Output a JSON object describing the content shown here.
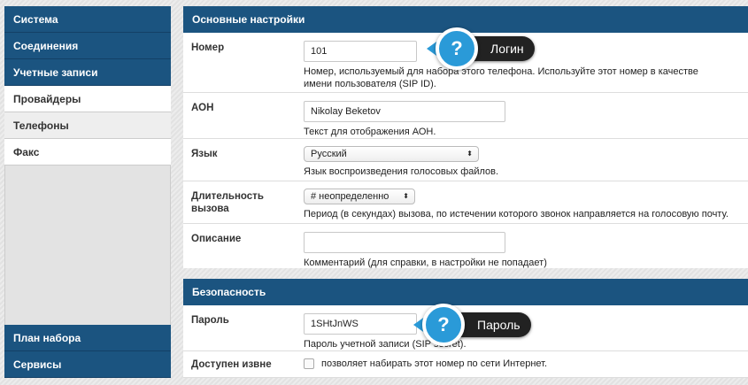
{
  "sidebar": {
    "top": [
      "Система",
      "Соединения",
      "Учетные записи"
    ],
    "sub": [
      "Провайдеры",
      "Телефоны",
      "Факс"
    ],
    "bottom": [
      "План набора",
      "Сервисы"
    ]
  },
  "basic": {
    "title": "Основные настройки",
    "number": {
      "label": "Номер",
      "value": "101",
      "desc": "Номер, используемый для набора этого телефона. Используйте этот номер в качестве имени пользователя (SIP ID)."
    },
    "aon": {
      "label": "АОН",
      "value": "Nikolay Beketov",
      "desc": "Текст для отображения АОН."
    },
    "lang": {
      "label": "Язык",
      "value": "Русский",
      "desc": "Язык воспроизведения голосовых файлов."
    },
    "duration": {
      "label": "Длительность вызова",
      "value": "# неопределенно",
      "desc": "Период (в секундах) вызова, по истечении которого звонок направляется на голосовую почту."
    },
    "description": {
      "label": "Описание",
      "value": "",
      "desc": "Комментарий (для справки, в настройки не попадает)"
    }
  },
  "security": {
    "title": "Безопасность",
    "password": {
      "label": "Пароль",
      "value": "1SHtJnWS",
      "desc": "Пароль учетной записи (SIP secret)."
    },
    "external": {
      "label": "Доступен извне",
      "desc": "позволяет набирать этот номер по сети Интернет."
    }
  },
  "tips": {
    "login": "Логин",
    "password": "Пароль",
    "icon": "?"
  }
}
